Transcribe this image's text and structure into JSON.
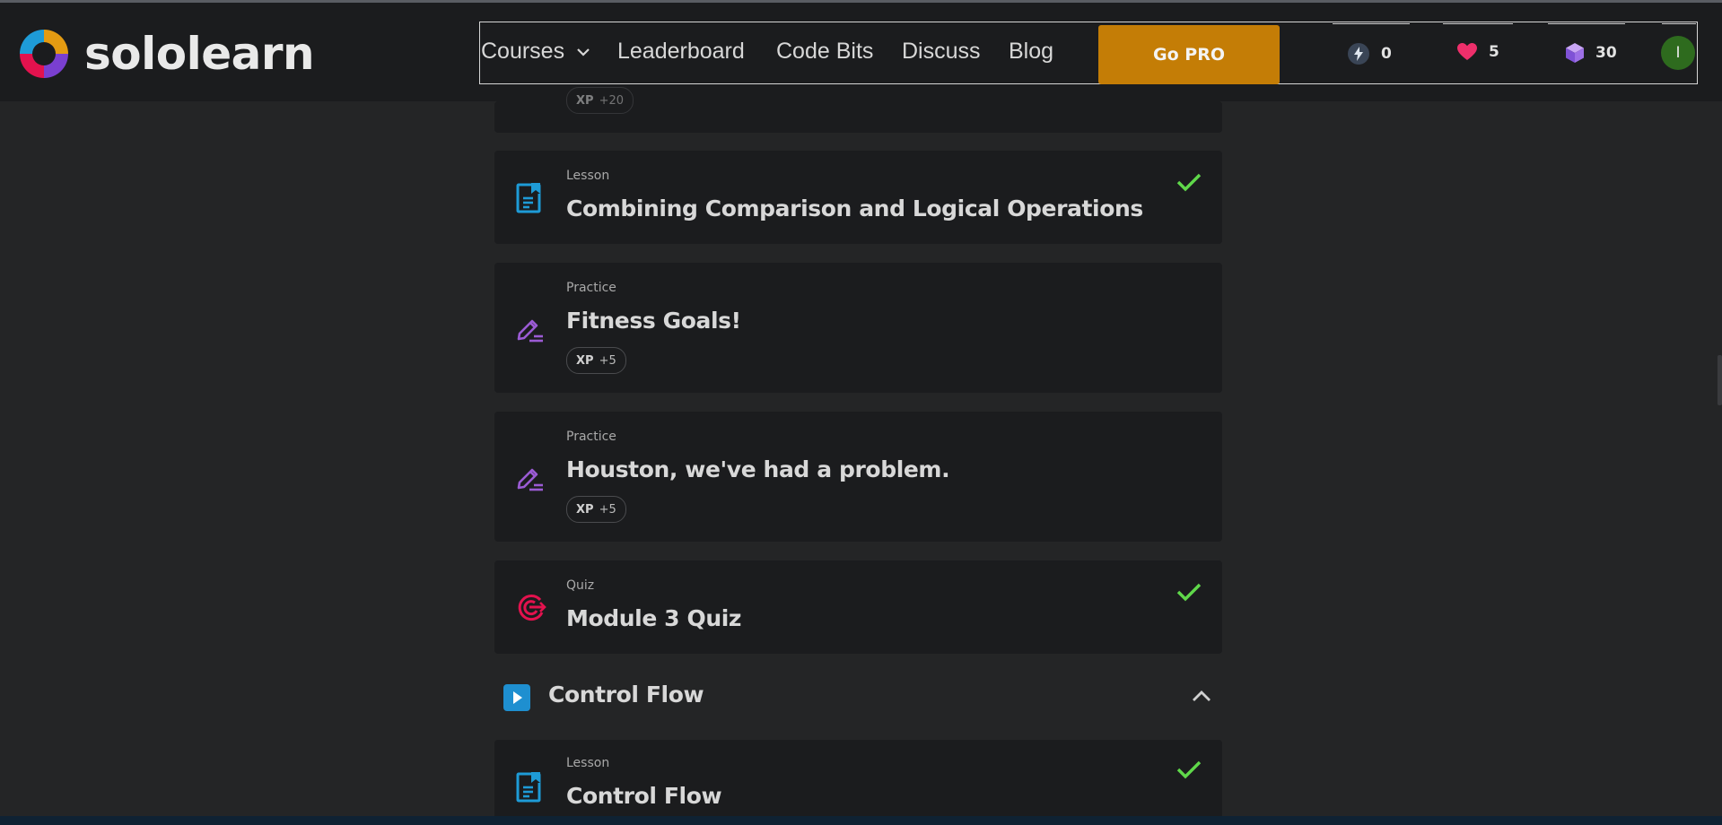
{
  "brand": {
    "name": "sololearn"
  },
  "nav": {
    "courses": "Courses",
    "leaderboard": "Leaderboard",
    "code_bits": "Code Bits",
    "discuss": "Discuss",
    "blog": "Blog",
    "go_pro": "Go PRO"
  },
  "stats": {
    "streak": "0",
    "hearts": "5",
    "gems": "30"
  },
  "user": {
    "initial": "I"
  },
  "partial_card": {
    "xp_label": "XP",
    "xp_value": "+20"
  },
  "items": [
    {
      "type": "Lesson",
      "title": "Combining Comparison and Logical Operations",
      "icon": "lesson-icon",
      "completed": true
    },
    {
      "type": "Practice",
      "title": "Fitness Goals!",
      "icon": "practice-pencil-icon",
      "xp_label": "XP",
      "xp_value": "+5",
      "completed": false
    },
    {
      "type": "Practice",
      "title": "Houston, we've had a problem.",
      "icon": "practice-pencil-icon",
      "xp_label": "XP",
      "xp_value": "+5",
      "completed": false
    },
    {
      "type": "Quiz",
      "title": "Module 3 Quiz",
      "icon": "quiz-target-icon",
      "completed": true
    }
  ],
  "section": {
    "title": "Control Flow",
    "expanded": true
  },
  "section_items": [
    {
      "type": "Lesson",
      "title": "Control Flow",
      "icon": "lesson-icon",
      "completed": true
    }
  ],
  "colors": {
    "background": "#242526",
    "card": "#1b1c1e",
    "go_pro": "#c47d06",
    "check": "#5fd84a",
    "lesson_icon": "#1e9bd7",
    "practice_icon": "#9b5bd4",
    "quiz_icon": "#e3124e"
  }
}
